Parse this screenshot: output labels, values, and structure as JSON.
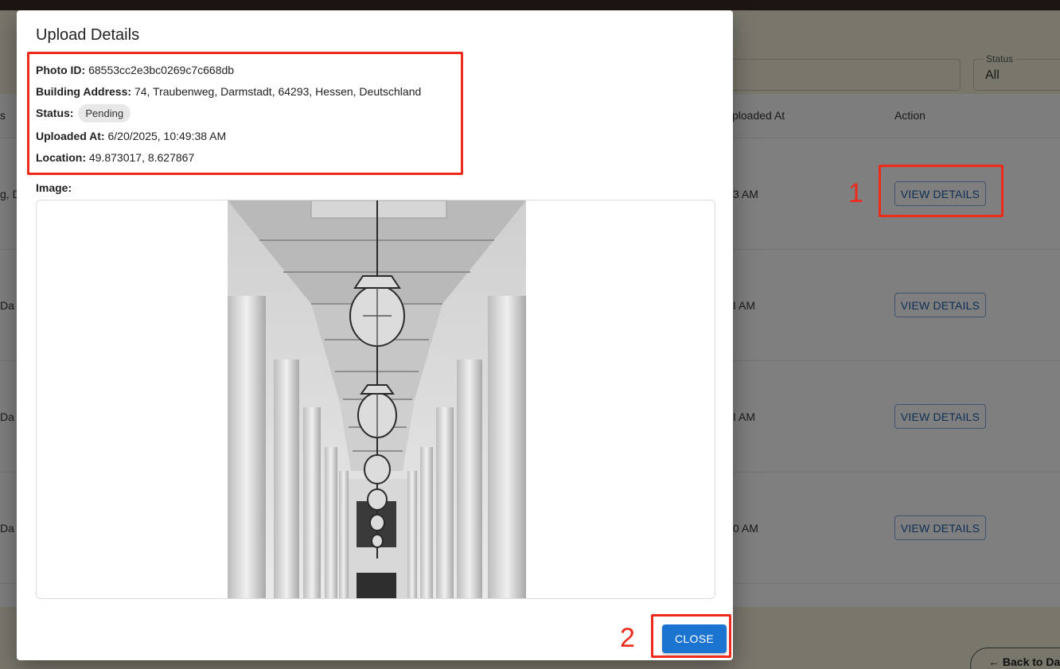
{
  "background": {
    "status_filter": {
      "label": "Status",
      "value": "All"
    },
    "table": {
      "headers": {
        "left_fragment": "s",
        "uploaded_at": "ploaded At",
        "action": "Action"
      },
      "rows": [
        {
          "address_fragment": "g, D",
          "time_fragment": "3 AM",
          "action_label": "VIEW DETAILS"
        },
        {
          "address_fragment": "Da",
          "time_fragment": "I AM",
          "action_label": "VIEW DETAILS"
        },
        {
          "address_fragment": "Da",
          "time_fragment": "I AM",
          "action_label": "VIEW DETAILS"
        },
        {
          "address_fragment": "Da",
          "time_fragment": "0 AM",
          "action_label": "VIEW DETAILS"
        }
      ]
    },
    "back_button_label": "← Back to Da"
  },
  "dialog": {
    "title": "Upload Details",
    "photo_id_label": "Photo ID:",
    "photo_id": "68553cc2e3bc0269c7c668db",
    "address_label": "Building Address:",
    "address": "74, Traubenweg, Darmstadt, 64293, Hessen, Deutschland",
    "status_label": "Status:",
    "status": "Pending",
    "uploaded_label": "Uploaded At:",
    "uploaded_at": "6/20/2025, 10:49:38 AM",
    "location_label": "Location:",
    "location": "49.873017, 8.627867",
    "image_label": "Image:",
    "close_label": "CLOSE"
  },
  "annotations": {
    "marker_1": "1",
    "marker_2": "2"
  },
  "colors": {
    "accent": "#1b74d0",
    "annotation": "#ee2a1b",
    "page_bg": "#f3edd8",
    "topbar": "#3b2b25"
  }
}
